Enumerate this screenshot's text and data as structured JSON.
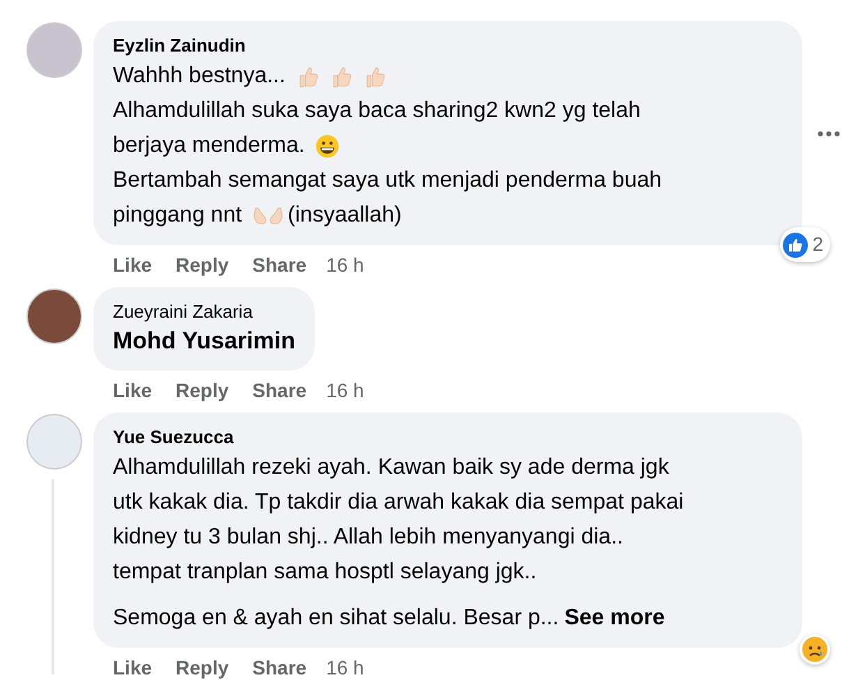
{
  "comments": [
    {
      "author": "Eyzlin Zainudin",
      "kind": "text",
      "more_menu": true,
      "lines": [
        [
          {
            "kind": "text",
            "text": "Wahhh bestnya..."
          },
          {
            "kind": "thumbs"
          },
          {
            "kind": "thumbs"
          },
          {
            "kind": "thumbs"
          }
        ],
        [
          {
            "kind": "text",
            "text": "Alhamdulillah suka saya baca sharing2 kwn2 yg telah"
          }
        ],
        [
          {
            "kind": "text",
            "text": "berjaya menderma."
          },
          {
            "kind": "grin"
          }
        ],
        [
          {
            "kind": "text",
            "text": "Bertambah semangat saya utk menjadi penderma buah"
          }
        ],
        [
          {
            "kind": "text",
            "text": "pinggang nnt"
          },
          {
            "kind": "palms"
          },
          {
            "kind": "text",
            "text": "(insyaallah)"
          }
        ]
      ],
      "actions": [
        "Like",
        "Reply",
        "Share"
      ],
      "time": "16 h",
      "reaction": {
        "kind": "like",
        "count": "2"
      }
    },
    {
      "author": "Zueyraini Zakaria",
      "kind": "tag",
      "tag": "Mohd Yusarimin",
      "more_menu": false,
      "actions": [
        "Like",
        "Reply",
        "Share"
      ],
      "time": "16 h"
    },
    {
      "author": "Yue Suezucca",
      "kind": "text",
      "more_menu": false,
      "lines": [
        [
          {
            "kind": "text",
            "text": "Alhamdulillah rezeki ayah. Kawan baik sy ade derma jgk"
          }
        ],
        [
          {
            "kind": "text",
            "text": "utk kakak dia. Tp takdir dia arwah kakak dia sempat pakai"
          }
        ],
        [
          {
            "kind": "text",
            "text": "kidney tu 3 bulan shj.. Allah lebih menyanyangi dia.."
          }
        ],
        [
          {
            "kind": "text",
            "text": "tempat tranplan sama hosptl selayang jgk.."
          }
        ],
        [
          {
            "kind": "gap"
          }
        ],
        [
          {
            "kind": "text",
            "text": "Semoga en & ayah en sihat selalu. Besar p..."
          },
          {
            "kind": "more",
            "text": "See more"
          }
        ]
      ],
      "actions": [
        "Like",
        "Reply",
        "Share"
      ],
      "time": "16 h",
      "reaction": {
        "kind": "sad"
      }
    }
  ]
}
